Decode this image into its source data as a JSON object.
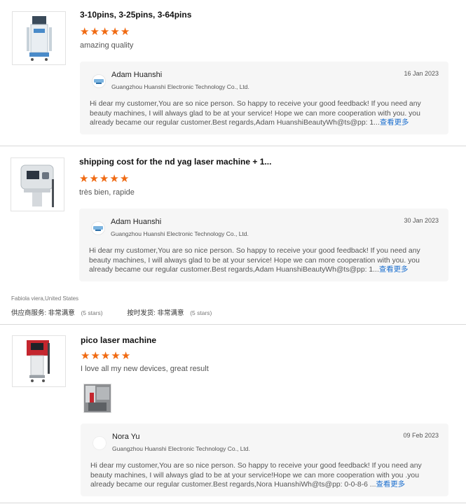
{
  "reviews": [
    {
      "product_title": "3-10pins, 3-25pins, 3-64pins",
      "rating": 5,
      "comment": "amazing quality",
      "reply": {
        "name": "Adam Huanshi",
        "company": "Guangzhou Huanshi Electronic Technology Co., Ltd.",
        "date": "16 Jan 2023",
        "text": "Hi dear my customer,You are so nice person. So happy to receive your good feedback! If you need any beauty machines, I will always glad to be at your service! Hope we can more cooperation with you. you already became our regular customer.Best regards,Adam HuanshiBeautyWh@ts@pp: 1...",
        "more": "查看更多"
      }
    },
    {
      "product_title": "shipping cost for the nd yag laser machine + 1...",
      "rating": 5,
      "comment": "très bien, rapide",
      "reply": {
        "name": "Adam Huanshi",
        "company": "Guangzhou Huanshi Electronic Technology Co., Ltd.",
        "date": "30 Jan 2023",
        "text": "Hi dear my customer,You are so nice person. So happy to receive your good feedback! If you need any beauty machines, I will always glad to be at your service! Hope we can more cooperation with you. you already became our regular customer.Best regards,Adam HuanshiBeautyWh@ts@pp: 1...",
        "more": "查看更多"
      }
    },
    {
      "product_title": "pico laser machine",
      "rating": 5,
      "comment": "I love all my new devices, great result",
      "reply": {
        "name": "Nora Yu",
        "company": "Guangzhou Huanshi Electronic Technology Co., Ltd.",
        "date": "09 Feb 2023",
        "text": "Hi dear my customer,You are so nice person. So happy to receive your good feedback! If you need any beauty machines, I will always glad to be at your service!Hope we can more cooperation with you .you already became our regular customer.Best regards,Nora HuanshiWh@ts@pp: 0-0-8-6 ...",
        "more": "查看更多"
      }
    }
  ],
  "buyer": {
    "name_location": "Fabiola viera,United States",
    "supplier_service_label": "供应商服务:",
    "supplier_service_value": "非常满意",
    "supplier_service_stars": "(5 stars)",
    "on_time_label": "按时发货:",
    "on_time_value": "非常满意",
    "on_time_stars": "(5 stars)"
  },
  "colors": {
    "star": "#f06a12",
    "link": "#1b6fcf",
    "reply_bg": "#f6f6f6"
  },
  "icons": [
    "star-icon",
    "supplier-logo-icon",
    "product-thumbnail",
    "review-photo"
  ]
}
